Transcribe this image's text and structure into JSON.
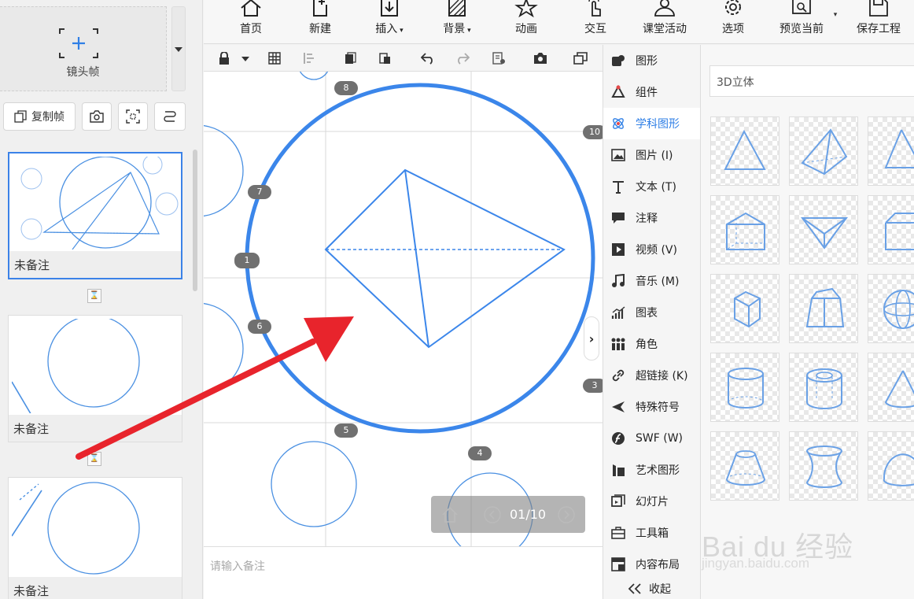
{
  "colors": {
    "accent": "#2f7fe6",
    "shape_blue": "#4a90e2",
    "arrow_red": "#e8242c"
  },
  "left_panel": {
    "camera_frame_label": "镜头帧",
    "copy_frame_label": "复制帧",
    "slides": [
      {
        "note": "未备注"
      },
      {
        "note": "未备注"
      },
      {
        "note": "未备注"
      }
    ]
  },
  "toolbar": {
    "items": [
      {
        "label": "首页",
        "icon": "home-icon"
      },
      {
        "label": "新建",
        "icon": "new-icon"
      },
      {
        "label": "插入",
        "icon": "insert-icon"
      },
      {
        "label": "背景",
        "icon": "background-icon"
      },
      {
        "label": "动画",
        "icon": "animation-icon"
      },
      {
        "label": "交互",
        "icon": "interaction-icon"
      },
      {
        "label": "课堂活动",
        "icon": "classroom-icon"
      },
      {
        "label": "选项",
        "icon": "gear-icon"
      },
      {
        "label": "预览当前",
        "icon": "preview-icon"
      },
      {
        "label": "保存工程",
        "icon": "save-icon"
      }
    ]
  },
  "canvas": {
    "pills": [
      "8",
      "7",
      "1",
      "6",
      "5",
      "4",
      "10",
      "3"
    ],
    "page_indicator": "01/10",
    "notes_placeholder": "请输入备注"
  },
  "categories": [
    {
      "label": "图形",
      "icon": "shape-icon"
    },
    {
      "label": "组件",
      "icon": "component-icon"
    },
    {
      "label": "学科图形",
      "icon": "subject-icon",
      "active": true
    },
    {
      "label": "图片 (I)",
      "icon": "image-icon"
    },
    {
      "label": "文本 (T)",
      "icon": "text-icon"
    },
    {
      "label": "注释",
      "icon": "comment-icon"
    },
    {
      "label": "视频 (V)",
      "icon": "video-icon"
    },
    {
      "label": "音乐 (M)",
      "icon": "music-icon"
    },
    {
      "label": "图表",
      "icon": "chart-icon"
    },
    {
      "label": "角色",
      "icon": "role-icon"
    },
    {
      "label": "超链接 (K)",
      "icon": "link-icon"
    },
    {
      "label": "特殊符号",
      "icon": "symbol-icon"
    },
    {
      "label": "SWF (W)",
      "icon": "swf-icon"
    },
    {
      "label": "艺术图形",
      "icon": "art-icon"
    },
    {
      "label": "幻灯片",
      "icon": "slide-icon"
    },
    {
      "label": "工具箱",
      "icon": "toolbox-icon"
    },
    {
      "label": "内容布局",
      "icon": "layout-icon"
    },
    {
      "label": "收起",
      "icon": "collapse-icon"
    }
  ],
  "resources": {
    "dropdown_value": "3D立体"
  },
  "watermark": {
    "line1": "Bai du 经验",
    "line2": "jingyan.baidu.com"
  }
}
